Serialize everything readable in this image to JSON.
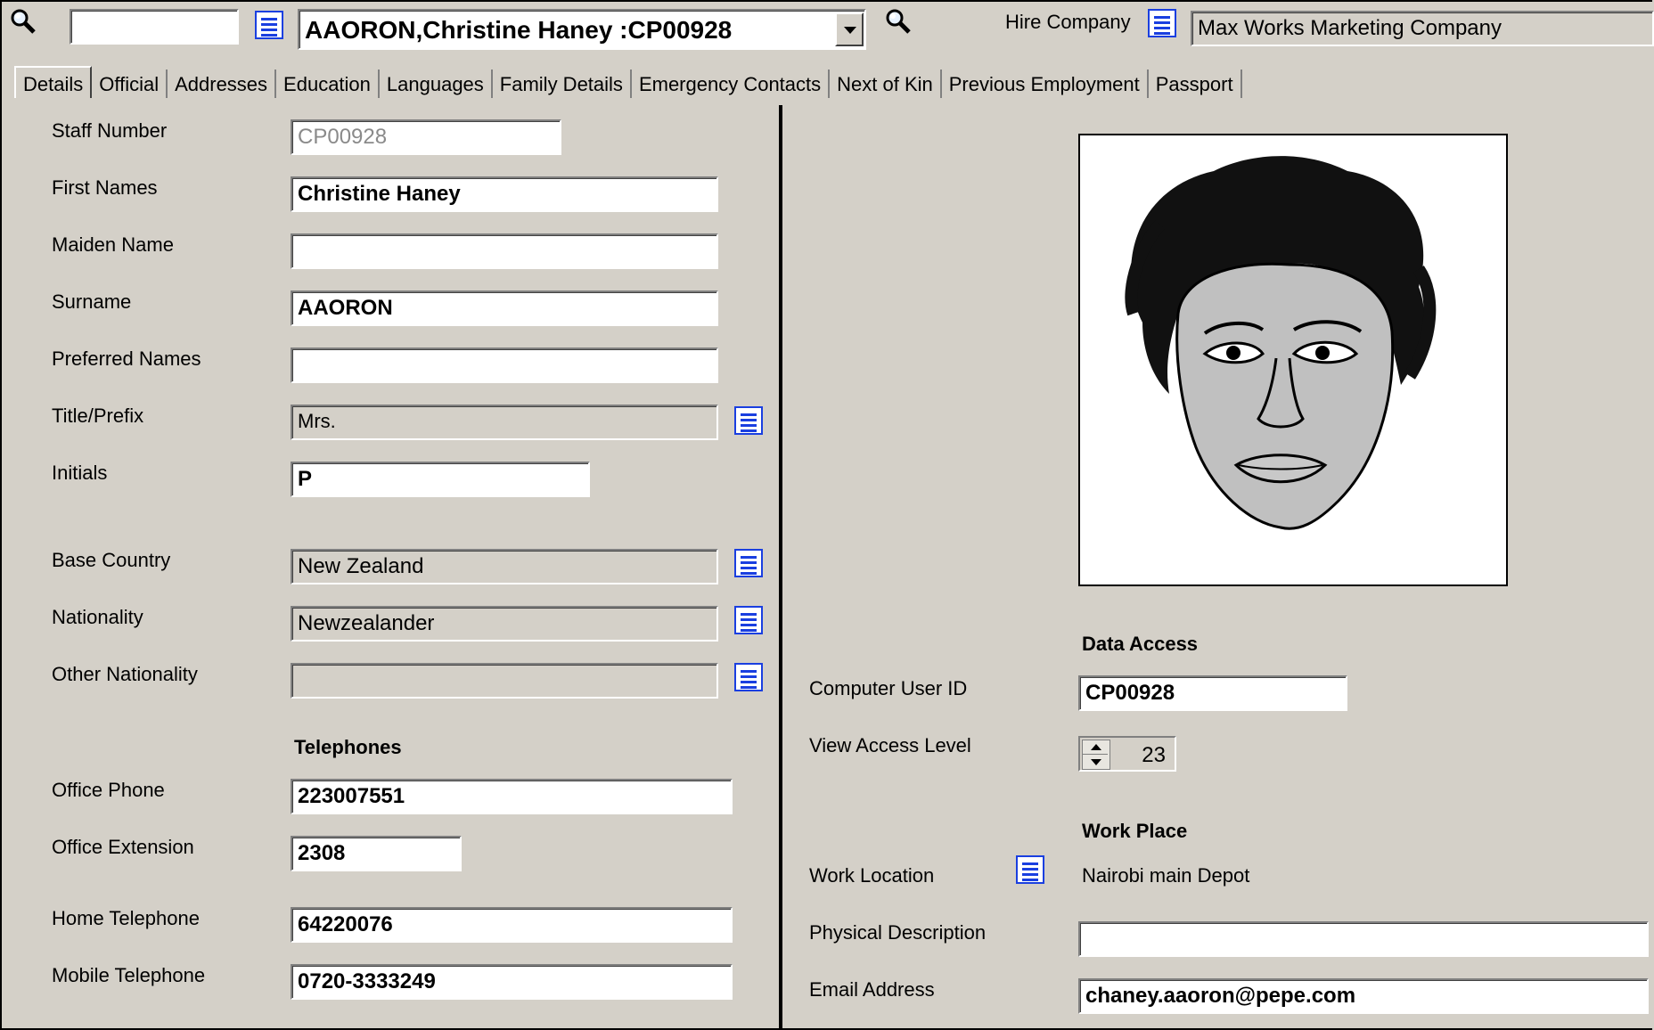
{
  "toolbar": {
    "quick_search_value": "",
    "employee_selector_value": "AAORON,Christine Haney :CP00928",
    "hire_company_label": "Hire Company",
    "hire_company_value": "Max Works Marketing Company"
  },
  "tabs": [
    "Details",
    "Official",
    "Addresses",
    "Education",
    "Languages",
    "Family Details",
    "Emergency Contacts",
    "Next of Kin",
    "Previous Employment",
    "Passport"
  ],
  "active_tab": "Details",
  "details": {
    "staff_number_label": "Staff Number",
    "staff_number_value": "CP00928",
    "first_names_label": "First Names",
    "first_names_value": "Christine Haney",
    "maiden_name_label": "Maiden Name",
    "maiden_name_value": "",
    "surname_label": "Surname",
    "surname_value": "AAORON",
    "preferred_names_label": "Preferred Names",
    "preferred_names_value": "",
    "title_label": "Title/Prefix",
    "title_value": "Mrs.",
    "initials_label": "Initials",
    "initials_value": "P",
    "base_country_label": "Base Country",
    "base_country_value": "New Zealand",
    "nationality_label": "Nationality",
    "nationality_value": "Newzealander",
    "other_nationality_label": "Other Nationality",
    "other_nationality_value": ""
  },
  "telephones": {
    "heading": "Telephones",
    "office_phone_label": "Office Phone",
    "office_phone_value": "223007551",
    "office_extension_label": "Office Extension",
    "office_extension_value": "2308",
    "home_telephone_label": "Home Telephone",
    "home_telephone_value": "64220076",
    "mobile_telephone_label": "Mobile Telephone",
    "mobile_telephone_value": "0720-3333249"
  },
  "data_access": {
    "heading": "Data Access",
    "computer_user_id_label": "Computer User ID",
    "computer_user_id_value": "CP00928",
    "view_access_level_label": "View Access Level",
    "view_access_level_value": "23"
  },
  "work_place": {
    "heading": "Work Place",
    "work_location_label": "Work Location",
    "work_location_value": "Nairobi main Depot",
    "physical_description_label": "Physical Description",
    "physical_description_value": "",
    "email_label": "Email Address",
    "email_value": "chaney.aaoron@pepe.com"
  },
  "icons": {
    "search": "magnifier-icon",
    "lookup": "list-lookup-icon",
    "photo": "employee-photo"
  },
  "colors": {
    "window_bg": "#d4d0c8",
    "lookup_blue": "#1a3fe0"
  }
}
